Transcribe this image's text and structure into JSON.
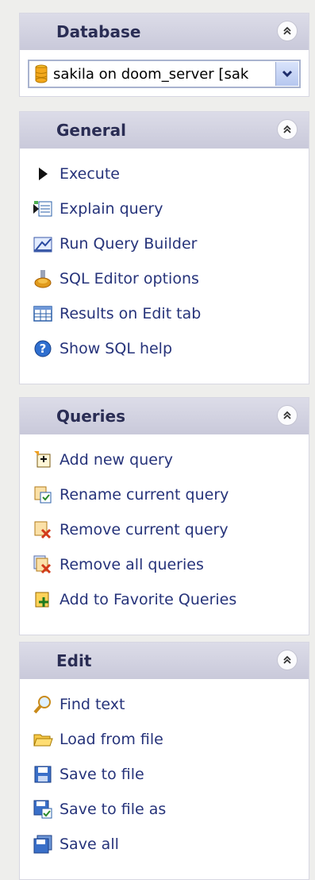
{
  "panels": {
    "database": {
      "title": "Database",
      "selected_connection": "sakila on doom_server [sak"
    },
    "general": {
      "title": "General",
      "items": [
        {
          "label": "Execute",
          "icon": "execute-icon"
        },
        {
          "label": "Explain query",
          "icon": "explain-query-icon"
        },
        {
          "label": "Run Query Builder",
          "icon": "query-builder-icon"
        },
        {
          "label": "SQL Editor options",
          "icon": "options-icon"
        },
        {
          "label": "Results on Edit tab",
          "icon": "results-icon"
        },
        {
          "label": "Show SQL help",
          "icon": "help-icon"
        }
      ]
    },
    "queries": {
      "title": "Queries",
      "items": [
        {
          "label": "Add new query",
          "icon": "add-query-icon"
        },
        {
          "label": "Rename current query",
          "icon": "rename-query-icon"
        },
        {
          "label": "Remove current query",
          "icon": "remove-query-icon"
        },
        {
          "label": "Remove all queries",
          "icon": "remove-all-queries-icon"
        },
        {
          "label": "Add to Favorite Queries",
          "icon": "favorite-queries-icon"
        }
      ]
    },
    "edit": {
      "title": "Edit",
      "items": [
        {
          "label": "Find text",
          "icon": "find-icon"
        },
        {
          "label": "Load from file",
          "icon": "open-folder-icon"
        },
        {
          "label": "Save to file",
          "icon": "save-icon"
        },
        {
          "label": "Save to file as",
          "icon": "save-as-icon"
        },
        {
          "label": "Save all",
          "icon": "save-all-icon"
        }
      ]
    }
  }
}
